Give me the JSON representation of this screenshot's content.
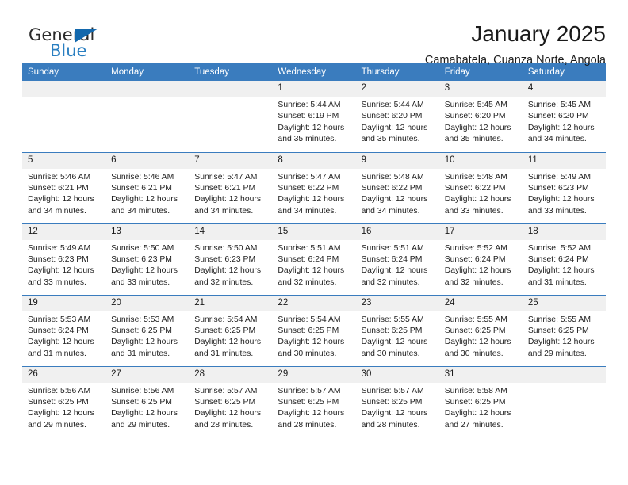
{
  "brand": {
    "name_top": "General",
    "name_bottom": "Blue",
    "accent_color": "#1368ad",
    "blue_text_color": "#2a7fc1",
    "triangle_icon": "triangle-icon"
  },
  "header": {
    "title": "January 2025",
    "subtitle": "Camabatela, Cuanza Norte, Angola",
    "header_bg": "#3a7cbe",
    "daynum_bg": "#f0f0f0"
  },
  "weekday_headers": [
    "Sunday",
    "Monday",
    "Tuesday",
    "Wednesday",
    "Thursday",
    "Friday",
    "Saturday"
  ],
  "weeks": [
    [
      {
        "day": "",
        "sunrise": "",
        "sunset": "",
        "daylight1": "",
        "daylight2": ""
      },
      {
        "day": "",
        "sunrise": "",
        "sunset": "",
        "daylight1": "",
        "daylight2": ""
      },
      {
        "day": "",
        "sunrise": "",
        "sunset": "",
        "daylight1": "",
        "daylight2": ""
      },
      {
        "day": "1",
        "sunrise": "Sunrise: 5:44 AM",
        "sunset": "Sunset: 6:19 PM",
        "daylight1": "Daylight: 12 hours",
        "daylight2": "and 35 minutes."
      },
      {
        "day": "2",
        "sunrise": "Sunrise: 5:44 AM",
        "sunset": "Sunset: 6:20 PM",
        "daylight1": "Daylight: 12 hours",
        "daylight2": "and 35 minutes."
      },
      {
        "day": "3",
        "sunrise": "Sunrise: 5:45 AM",
        "sunset": "Sunset: 6:20 PM",
        "daylight1": "Daylight: 12 hours",
        "daylight2": "and 35 minutes."
      },
      {
        "day": "4",
        "sunrise": "Sunrise: 5:45 AM",
        "sunset": "Sunset: 6:20 PM",
        "daylight1": "Daylight: 12 hours",
        "daylight2": "and 34 minutes."
      }
    ],
    [
      {
        "day": "5",
        "sunrise": "Sunrise: 5:46 AM",
        "sunset": "Sunset: 6:21 PM",
        "daylight1": "Daylight: 12 hours",
        "daylight2": "and 34 minutes."
      },
      {
        "day": "6",
        "sunrise": "Sunrise: 5:46 AM",
        "sunset": "Sunset: 6:21 PM",
        "daylight1": "Daylight: 12 hours",
        "daylight2": "and 34 minutes."
      },
      {
        "day": "7",
        "sunrise": "Sunrise: 5:47 AM",
        "sunset": "Sunset: 6:21 PM",
        "daylight1": "Daylight: 12 hours",
        "daylight2": "and 34 minutes."
      },
      {
        "day": "8",
        "sunrise": "Sunrise: 5:47 AM",
        "sunset": "Sunset: 6:22 PM",
        "daylight1": "Daylight: 12 hours",
        "daylight2": "and 34 minutes."
      },
      {
        "day": "9",
        "sunrise": "Sunrise: 5:48 AM",
        "sunset": "Sunset: 6:22 PM",
        "daylight1": "Daylight: 12 hours",
        "daylight2": "and 34 minutes."
      },
      {
        "day": "10",
        "sunrise": "Sunrise: 5:48 AM",
        "sunset": "Sunset: 6:22 PM",
        "daylight1": "Daylight: 12 hours",
        "daylight2": "and 33 minutes."
      },
      {
        "day": "11",
        "sunrise": "Sunrise: 5:49 AM",
        "sunset": "Sunset: 6:23 PM",
        "daylight1": "Daylight: 12 hours",
        "daylight2": "and 33 minutes."
      }
    ],
    [
      {
        "day": "12",
        "sunrise": "Sunrise: 5:49 AM",
        "sunset": "Sunset: 6:23 PM",
        "daylight1": "Daylight: 12 hours",
        "daylight2": "and 33 minutes."
      },
      {
        "day": "13",
        "sunrise": "Sunrise: 5:50 AM",
        "sunset": "Sunset: 6:23 PM",
        "daylight1": "Daylight: 12 hours",
        "daylight2": "and 33 minutes."
      },
      {
        "day": "14",
        "sunrise": "Sunrise: 5:50 AM",
        "sunset": "Sunset: 6:23 PM",
        "daylight1": "Daylight: 12 hours",
        "daylight2": "and 32 minutes."
      },
      {
        "day": "15",
        "sunrise": "Sunrise: 5:51 AM",
        "sunset": "Sunset: 6:24 PM",
        "daylight1": "Daylight: 12 hours",
        "daylight2": "and 32 minutes."
      },
      {
        "day": "16",
        "sunrise": "Sunrise: 5:51 AM",
        "sunset": "Sunset: 6:24 PM",
        "daylight1": "Daylight: 12 hours",
        "daylight2": "and 32 minutes."
      },
      {
        "day": "17",
        "sunrise": "Sunrise: 5:52 AM",
        "sunset": "Sunset: 6:24 PM",
        "daylight1": "Daylight: 12 hours",
        "daylight2": "and 32 minutes."
      },
      {
        "day": "18",
        "sunrise": "Sunrise: 5:52 AM",
        "sunset": "Sunset: 6:24 PM",
        "daylight1": "Daylight: 12 hours",
        "daylight2": "and 31 minutes."
      }
    ],
    [
      {
        "day": "19",
        "sunrise": "Sunrise: 5:53 AM",
        "sunset": "Sunset: 6:24 PM",
        "daylight1": "Daylight: 12 hours",
        "daylight2": "and 31 minutes."
      },
      {
        "day": "20",
        "sunrise": "Sunrise: 5:53 AM",
        "sunset": "Sunset: 6:25 PM",
        "daylight1": "Daylight: 12 hours",
        "daylight2": "and 31 minutes."
      },
      {
        "day": "21",
        "sunrise": "Sunrise: 5:54 AM",
        "sunset": "Sunset: 6:25 PM",
        "daylight1": "Daylight: 12 hours",
        "daylight2": "and 31 minutes."
      },
      {
        "day": "22",
        "sunrise": "Sunrise: 5:54 AM",
        "sunset": "Sunset: 6:25 PM",
        "daylight1": "Daylight: 12 hours",
        "daylight2": "and 30 minutes."
      },
      {
        "day": "23",
        "sunrise": "Sunrise: 5:55 AM",
        "sunset": "Sunset: 6:25 PM",
        "daylight1": "Daylight: 12 hours",
        "daylight2": "and 30 minutes."
      },
      {
        "day": "24",
        "sunrise": "Sunrise: 5:55 AM",
        "sunset": "Sunset: 6:25 PM",
        "daylight1": "Daylight: 12 hours",
        "daylight2": "and 30 minutes."
      },
      {
        "day": "25",
        "sunrise": "Sunrise: 5:55 AM",
        "sunset": "Sunset: 6:25 PM",
        "daylight1": "Daylight: 12 hours",
        "daylight2": "and 29 minutes."
      }
    ],
    [
      {
        "day": "26",
        "sunrise": "Sunrise: 5:56 AM",
        "sunset": "Sunset: 6:25 PM",
        "daylight1": "Daylight: 12 hours",
        "daylight2": "and 29 minutes."
      },
      {
        "day": "27",
        "sunrise": "Sunrise: 5:56 AM",
        "sunset": "Sunset: 6:25 PM",
        "daylight1": "Daylight: 12 hours",
        "daylight2": "and 29 minutes."
      },
      {
        "day": "28",
        "sunrise": "Sunrise: 5:57 AM",
        "sunset": "Sunset: 6:25 PM",
        "daylight1": "Daylight: 12 hours",
        "daylight2": "and 28 minutes."
      },
      {
        "day": "29",
        "sunrise": "Sunrise: 5:57 AM",
        "sunset": "Sunset: 6:25 PM",
        "daylight1": "Daylight: 12 hours",
        "daylight2": "and 28 minutes."
      },
      {
        "day": "30",
        "sunrise": "Sunrise: 5:57 AM",
        "sunset": "Sunset: 6:25 PM",
        "daylight1": "Daylight: 12 hours",
        "daylight2": "and 28 minutes."
      },
      {
        "day": "31",
        "sunrise": "Sunrise: 5:58 AM",
        "sunset": "Sunset: 6:25 PM",
        "daylight1": "Daylight: 12 hours",
        "daylight2": "and 27 minutes."
      },
      {
        "day": "",
        "sunrise": "",
        "sunset": "",
        "daylight1": "",
        "daylight2": ""
      }
    ]
  ]
}
